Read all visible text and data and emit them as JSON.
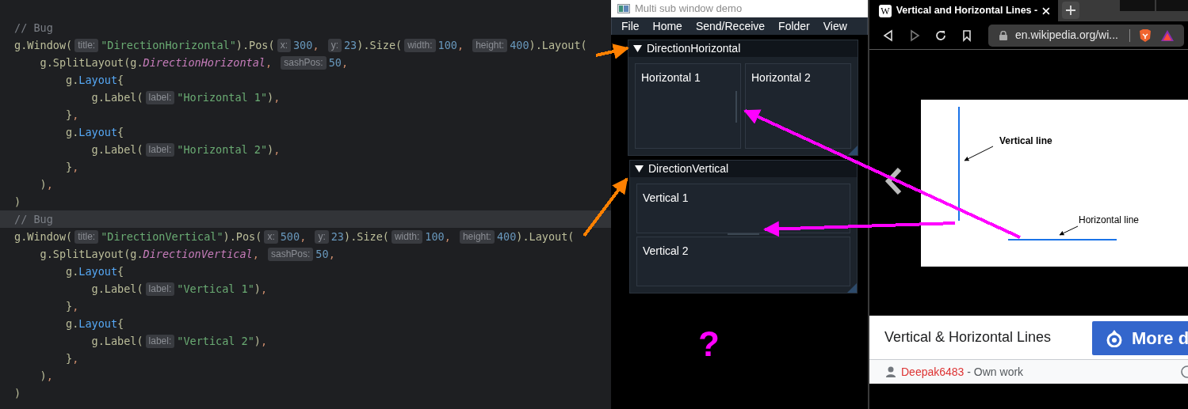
{
  "editor": {
    "lines": [
      {
        "current": false,
        "tokens": [
          {
            "kind": "comment",
            "text": "// Bug"
          }
        ]
      },
      {
        "current": false,
        "tokens": [
          {
            "kind": "code",
            "text": "g.Window("
          },
          {
            "kind": "hint",
            "text": "title:"
          },
          {
            "kind": "string",
            "text": "\"DirectionHorizontal\""
          },
          {
            "kind": "code",
            "text": ").Pos("
          },
          {
            "kind": "hint",
            "text": "x:"
          },
          {
            "kind": "number",
            "text": "300"
          },
          {
            "kind": "punct",
            "text": ", "
          },
          {
            "kind": "hint",
            "text": "y:"
          },
          {
            "kind": "number",
            "text": "23"
          },
          {
            "kind": "code",
            "text": ").Size("
          },
          {
            "kind": "hint",
            "text": "width:"
          },
          {
            "kind": "number",
            "text": "100"
          },
          {
            "kind": "punct",
            "text": ", "
          },
          {
            "kind": "hint",
            "text": "height:"
          },
          {
            "kind": "number",
            "text": "400"
          },
          {
            "kind": "code",
            "text": ").Layout("
          }
        ]
      },
      {
        "current": false,
        "tokens": [
          {
            "kind": "code",
            "text": "    g.SplitLayout(g."
          },
          {
            "kind": "param",
            "text": "DirectionHorizontal"
          },
          {
            "kind": "punct",
            "text": ", "
          },
          {
            "kind": "hint",
            "text": "sashPos:"
          },
          {
            "kind": "number",
            "text": "50"
          },
          {
            "kind": "punct",
            "text": ","
          }
        ]
      },
      {
        "current": false,
        "tokens": [
          {
            "kind": "code",
            "text": "        g."
          },
          {
            "kind": "method",
            "text": "Layout"
          },
          {
            "kind": "code",
            "text": "{"
          }
        ]
      },
      {
        "current": false,
        "tokens": [
          {
            "kind": "code",
            "text": "            g.Label("
          },
          {
            "kind": "hint",
            "text": "label:"
          },
          {
            "kind": "string",
            "text": "\"Horizontal 1\""
          },
          {
            "kind": "code",
            "text": ")"
          },
          {
            "kind": "punct",
            "text": ","
          }
        ]
      },
      {
        "current": false,
        "tokens": [
          {
            "kind": "code",
            "text": "        }"
          },
          {
            "kind": "punct",
            "text": ","
          }
        ]
      },
      {
        "current": false,
        "tokens": [
          {
            "kind": "code",
            "text": "        g."
          },
          {
            "kind": "method",
            "text": "Layout"
          },
          {
            "kind": "code",
            "text": "{"
          }
        ]
      },
      {
        "current": false,
        "tokens": [
          {
            "kind": "code",
            "text": "            g.Label("
          },
          {
            "kind": "hint",
            "text": "label:"
          },
          {
            "kind": "string",
            "text": "\"Horizontal 2\""
          },
          {
            "kind": "code",
            "text": ")"
          },
          {
            "kind": "punct",
            "text": ","
          }
        ]
      },
      {
        "current": false,
        "tokens": [
          {
            "kind": "code",
            "text": "        }"
          },
          {
            "kind": "punct",
            "text": ","
          }
        ]
      },
      {
        "current": false,
        "tokens": [
          {
            "kind": "code",
            "text": "    )"
          },
          {
            "kind": "punct",
            "text": ","
          }
        ]
      },
      {
        "current": false,
        "tokens": [
          {
            "kind": "code",
            "text": ")"
          }
        ]
      },
      {
        "current": true,
        "tokens": [
          {
            "kind": "comment",
            "text": "// Bug"
          }
        ]
      },
      {
        "current": false,
        "tokens": [
          {
            "kind": "code",
            "text": "g.Window("
          },
          {
            "kind": "hint",
            "text": "title:"
          },
          {
            "kind": "string",
            "text": "\"DirectionVertical\""
          },
          {
            "kind": "code",
            "text": ").Pos("
          },
          {
            "kind": "hint",
            "text": "x:"
          },
          {
            "kind": "number",
            "text": "500"
          },
          {
            "kind": "punct",
            "text": ", "
          },
          {
            "kind": "hint",
            "text": "y:"
          },
          {
            "kind": "number",
            "text": "23"
          },
          {
            "kind": "code",
            "text": ").Size("
          },
          {
            "kind": "hint",
            "text": "width:"
          },
          {
            "kind": "number",
            "text": "100"
          },
          {
            "kind": "punct",
            "text": ", "
          },
          {
            "kind": "hint",
            "text": "height:"
          },
          {
            "kind": "number",
            "text": "400"
          },
          {
            "kind": "code",
            "text": ").Layout("
          }
        ]
      },
      {
        "current": false,
        "tokens": [
          {
            "kind": "code",
            "text": "    g.SplitLayout(g."
          },
          {
            "kind": "param",
            "text": "DirectionVertical"
          },
          {
            "kind": "punct",
            "text": ", "
          },
          {
            "kind": "hint",
            "text": "sashPos:"
          },
          {
            "kind": "number",
            "text": "50"
          },
          {
            "kind": "punct",
            "text": ","
          }
        ]
      },
      {
        "current": false,
        "tokens": [
          {
            "kind": "code",
            "text": "        g."
          },
          {
            "kind": "method",
            "text": "Layout"
          },
          {
            "kind": "code",
            "text": "{"
          }
        ]
      },
      {
        "current": false,
        "tokens": [
          {
            "kind": "code",
            "text": "            g.Label("
          },
          {
            "kind": "hint",
            "text": "label:"
          },
          {
            "kind": "string",
            "text": "\"Vertical 1\""
          },
          {
            "kind": "code",
            "text": ")"
          },
          {
            "kind": "punct",
            "text": ","
          }
        ]
      },
      {
        "current": false,
        "tokens": [
          {
            "kind": "code",
            "text": "        }"
          },
          {
            "kind": "punct",
            "text": ","
          }
        ]
      },
      {
        "current": false,
        "tokens": [
          {
            "kind": "code",
            "text": "        g."
          },
          {
            "kind": "method",
            "text": "Layout"
          },
          {
            "kind": "code",
            "text": "{"
          }
        ]
      },
      {
        "current": false,
        "tokens": [
          {
            "kind": "code",
            "text": "            g.Label("
          },
          {
            "kind": "hint",
            "text": "label:"
          },
          {
            "kind": "string",
            "text": "\"Vertical 2\""
          },
          {
            "kind": "code",
            "text": ")"
          },
          {
            "kind": "punct",
            "text": ","
          }
        ]
      },
      {
        "current": false,
        "tokens": [
          {
            "kind": "code",
            "text": "        }"
          },
          {
            "kind": "punct",
            "text": ","
          }
        ]
      },
      {
        "current": false,
        "tokens": [
          {
            "kind": "code",
            "text": "    )"
          },
          {
            "kind": "punct",
            "text": ","
          }
        ]
      },
      {
        "current": false,
        "tokens": [
          {
            "kind": "code",
            "text": ")"
          }
        ]
      }
    ]
  },
  "app_window": {
    "title": "Multi sub window demo",
    "menu": [
      "File",
      "Home",
      "Send/Receive",
      "Folder",
      "View"
    ],
    "windows": [
      {
        "title": "DirectionHorizontal",
        "expanded": true,
        "kind": "horizontal",
        "panes": [
          "Horizontal 1",
          "Horizontal 2"
        ]
      },
      {
        "title": "DirectionVertical",
        "expanded": true,
        "kind": "vertical",
        "panes": [
          "Vertical 1",
          "Vertical 2"
        ]
      }
    ]
  },
  "browser": {
    "tab": {
      "favicon": "W",
      "title": "Vertical and Horizontal Lines -"
    },
    "url": "en.wikipedia.org/wi...",
    "figure": {
      "labels": [
        "Vertical line",
        "Horizontal line"
      ]
    },
    "caption": "Vertical & Horizontal Lines",
    "button": "More d",
    "credit": {
      "author": "Deepak6483",
      "suffix": " - Own work"
    }
  },
  "annotations": {
    "arrows": [
      {
        "color": "#ff8000"
      },
      {
        "color": "#ff8000"
      },
      {
        "color": "#ff00ff"
      },
      {
        "color": "#ff00ff"
      }
    ],
    "question_mark": "?"
  }
}
